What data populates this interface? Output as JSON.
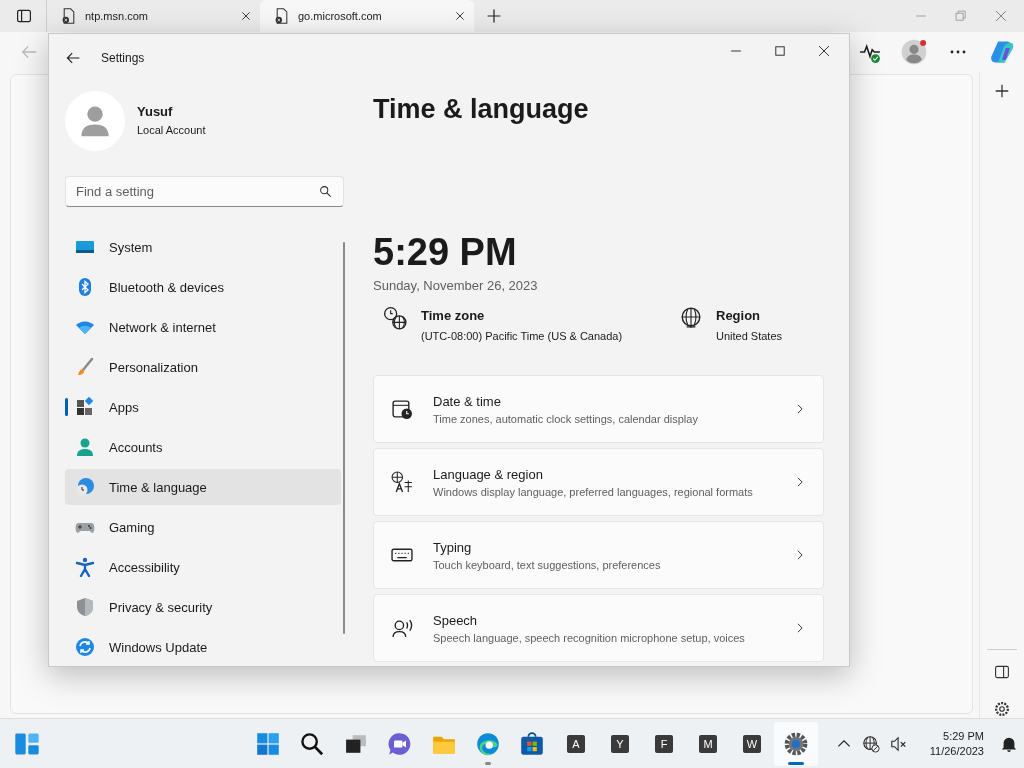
{
  "browser": {
    "tabs": [
      {
        "title": "ntp.msn.com",
        "selected": false
      },
      {
        "title": "go.microsoft.com",
        "selected": true
      }
    ]
  },
  "settings_window": {
    "title": "Settings",
    "user": {
      "name": "Yusuf",
      "account": "Local Account"
    },
    "search": {
      "placeholder": "Find a setting"
    },
    "nav": [
      {
        "label": "System",
        "kind": "system",
        "selected": false,
        "hovered": false
      },
      {
        "label": "Bluetooth & devices",
        "kind": "bluetooth",
        "selected": false,
        "hovered": false
      },
      {
        "label": "Network & internet",
        "kind": "network",
        "selected": false,
        "hovered": false
      },
      {
        "label": "Personalization",
        "kind": "personalization",
        "selected": false,
        "hovered": false
      },
      {
        "label": "Apps",
        "kind": "apps",
        "selected": true,
        "hovered": false
      },
      {
        "label": "Accounts",
        "kind": "accounts",
        "selected": false,
        "hovered": false
      },
      {
        "label": "Time & language",
        "kind": "time",
        "selected": false,
        "hovered": true
      },
      {
        "label": "Gaming",
        "kind": "gaming",
        "selected": false,
        "hovered": false
      },
      {
        "label": "Accessibility",
        "kind": "accessibility",
        "selected": false,
        "hovered": false
      },
      {
        "label": "Privacy & security",
        "kind": "privacy",
        "selected": false,
        "hovered": false
      },
      {
        "label": "Windows Update",
        "kind": "update",
        "selected": false,
        "hovered": false
      }
    ],
    "page_title": "Time & language",
    "time": "5:29 PM",
    "date": "Sunday, November 26, 2023",
    "info": [
      {
        "kind": "timezone",
        "label": "Time zone",
        "value": "(UTC-08:00) Pacific Time (US & Canada)"
      },
      {
        "kind": "region",
        "label": "Region",
        "value": "United States"
      }
    ],
    "cards": [
      {
        "kind": "datetime",
        "title": "Date & time",
        "description": "Time zones, automatic clock settings, calendar display"
      },
      {
        "kind": "language",
        "title": "Language & region",
        "description": "Windows display language, preferred languages, regional formats"
      },
      {
        "kind": "typing",
        "title": "Typing",
        "description": "Touch keyboard, text suggestions, preferences"
      },
      {
        "kind": "speech",
        "title": "Speech",
        "description": "Speech language, speech recognition microphone setup, voices"
      }
    ]
  },
  "taskbar": {
    "items": [
      {
        "kind": "start",
        "running": false,
        "active": false
      },
      {
        "kind": "search",
        "running": false,
        "active": false
      },
      {
        "kind": "taskview",
        "running": false,
        "active": false
      },
      {
        "kind": "chat",
        "running": false,
        "active": false
      },
      {
        "kind": "explorer",
        "running": false,
        "active": false
      },
      {
        "kind": "edge",
        "running": true,
        "active": false
      },
      {
        "kind": "store",
        "running": false,
        "active": false
      },
      {
        "kind": "letter",
        "letter": "A",
        "running": false,
        "active": false
      },
      {
        "kind": "letter",
        "letter": "Y",
        "running": false,
        "active": false
      },
      {
        "kind": "letter",
        "letter": "F",
        "running": false,
        "active": false
      },
      {
        "kind": "letter",
        "letter": "M",
        "running": false,
        "active": false
      },
      {
        "kind": "letter",
        "letter": "W",
        "running": false,
        "active": false
      },
      {
        "kind": "settings",
        "running": true,
        "active": true
      }
    ],
    "clock": {
      "time": "5:29 PM",
      "date": "11/26/2023"
    }
  }
}
